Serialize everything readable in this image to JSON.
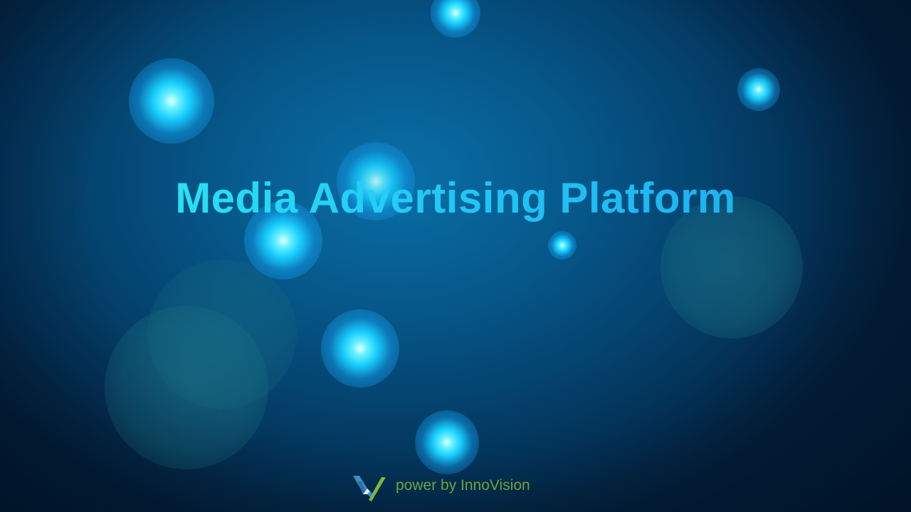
{
  "main": {
    "title": "Media Advertising Platform"
  },
  "footer": {
    "logo_icon": "innovision-logo-icon",
    "text": "power by InnoVision"
  },
  "colors": {
    "background": "#05507f",
    "title": "#26d6f2",
    "footer_text": "#6aa53a",
    "logo_blue": "#3a8fc8",
    "logo_green": "#7cb83a"
  }
}
